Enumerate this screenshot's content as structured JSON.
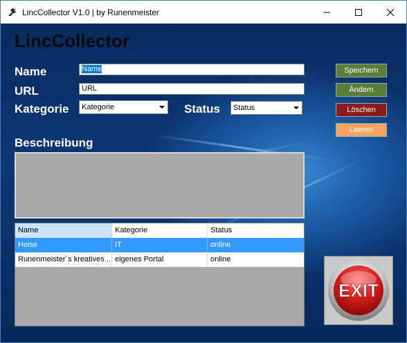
{
  "window": {
    "title": "LincCollector V1.0 | by Runenmeister"
  },
  "app_title": "LincCollector",
  "form": {
    "name_label": "Name",
    "name_value": "Name",
    "url_label": "URL",
    "url_value": "URL",
    "category_label": "Kategorie",
    "category_value": "Kategorie",
    "status_label": "Status",
    "status_value": "Status",
    "description_label": "Beschreibung"
  },
  "buttons": {
    "save": "Speichern",
    "edit": "Ändern",
    "delete": "Löschen",
    "clear": "Leeren",
    "exit": "EXIT"
  },
  "colors": {
    "save_bg": "#5a7d3a",
    "edit_bg": "#5a7d3a",
    "delete_bg": "#8b1a1a",
    "clear_bg": "#f4a460"
  },
  "table": {
    "columns": [
      "Name",
      "Kategorie",
      "Status"
    ],
    "rows": [
      [
        "Heise",
        "IT",
        "online"
      ],
      [
        "Runenmeister´s kreatives ...",
        "eigenes Portal",
        "online"
      ]
    ],
    "selected_row": 0
  }
}
